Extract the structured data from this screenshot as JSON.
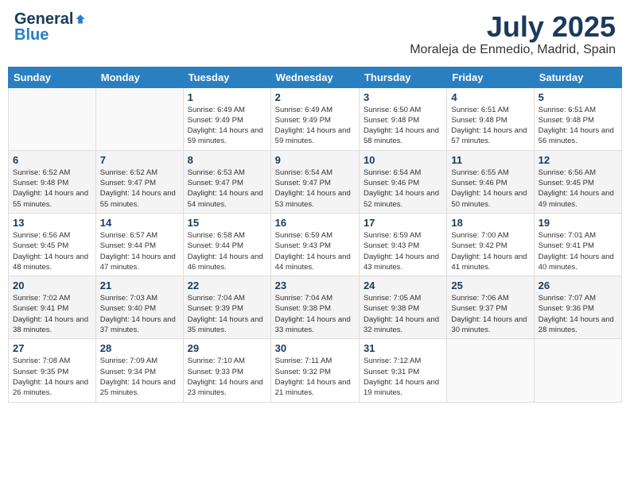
{
  "logo": {
    "general": "General",
    "blue": "Blue"
  },
  "header": {
    "title": "July 2025",
    "subtitle": "Moraleja de Enmedio, Madrid, Spain"
  },
  "weekdays": [
    "Sunday",
    "Monday",
    "Tuesday",
    "Wednesday",
    "Thursday",
    "Friday",
    "Saturday"
  ],
  "weeks": [
    [
      {
        "day": null
      },
      {
        "day": null
      },
      {
        "day": "1",
        "sunrise": "6:49 AM",
        "sunset": "9:49 PM",
        "daylight": "14 hours and 59 minutes."
      },
      {
        "day": "2",
        "sunrise": "6:49 AM",
        "sunset": "9:49 PM",
        "daylight": "14 hours and 59 minutes."
      },
      {
        "day": "3",
        "sunrise": "6:50 AM",
        "sunset": "9:48 PM",
        "daylight": "14 hours and 58 minutes."
      },
      {
        "day": "4",
        "sunrise": "6:51 AM",
        "sunset": "9:48 PM",
        "daylight": "14 hours and 57 minutes."
      },
      {
        "day": "5",
        "sunrise": "6:51 AM",
        "sunset": "9:48 PM",
        "daylight": "14 hours and 56 minutes."
      }
    ],
    [
      {
        "day": "6",
        "sunrise": "6:52 AM",
        "sunset": "9:48 PM",
        "daylight": "14 hours and 55 minutes."
      },
      {
        "day": "7",
        "sunrise": "6:52 AM",
        "sunset": "9:47 PM",
        "daylight": "14 hours and 55 minutes."
      },
      {
        "day": "8",
        "sunrise": "6:53 AM",
        "sunset": "9:47 PM",
        "daylight": "14 hours and 54 minutes."
      },
      {
        "day": "9",
        "sunrise": "6:54 AM",
        "sunset": "9:47 PM",
        "daylight": "14 hours and 53 minutes."
      },
      {
        "day": "10",
        "sunrise": "6:54 AM",
        "sunset": "9:46 PM",
        "daylight": "14 hours and 52 minutes."
      },
      {
        "day": "11",
        "sunrise": "6:55 AM",
        "sunset": "9:46 PM",
        "daylight": "14 hours and 50 minutes."
      },
      {
        "day": "12",
        "sunrise": "6:56 AM",
        "sunset": "9:45 PM",
        "daylight": "14 hours and 49 minutes."
      }
    ],
    [
      {
        "day": "13",
        "sunrise": "6:56 AM",
        "sunset": "9:45 PM",
        "daylight": "14 hours and 48 minutes."
      },
      {
        "day": "14",
        "sunrise": "6:57 AM",
        "sunset": "9:44 PM",
        "daylight": "14 hours and 47 minutes."
      },
      {
        "day": "15",
        "sunrise": "6:58 AM",
        "sunset": "9:44 PM",
        "daylight": "14 hours and 46 minutes."
      },
      {
        "day": "16",
        "sunrise": "6:59 AM",
        "sunset": "9:43 PM",
        "daylight": "14 hours and 44 minutes."
      },
      {
        "day": "17",
        "sunrise": "6:59 AM",
        "sunset": "9:43 PM",
        "daylight": "14 hours and 43 minutes."
      },
      {
        "day": "18",
        "sunrise": "7:00 AM",
        "sunset": "9:42 PM",
        "daylight": "14 hours and 41 minutes."
      },
      {
        "day": "19",
        "sunrise": "7:01 AM",
        "sunset": "9:41 PM",
        "daylight": "14 hours and 40 minutes."
      }
    ],
    [
      {
        "day": "20",
        "sunrise": "7:02 AM",
        "sunset": "9:41 PM",
        "daylight": "14 hours and 38 minutes."
      },
      {
        "day": "21",
        "sunrise": "7:03 AM",
        "sunset": "9:40 PM",
        "daylight": "14 hours and 37 minutes."
      },
      {
        "day": "22",
        "sunrise": "7:04 AM",
        "sunset": "9:39 PM",
        "daylight": "14 hours and 35 minutes."
      },
      {
        "day": "23",
        "sunrise": "7:04 AM",
        "sunset": "9:38 PM",
        "daylight": "14 hours and 33 minutes."
      },
      {
        "day": "24",
        "sunrise": "7:05 AM",
        "sunset": "9:38 PM",
        "daylight": "14 hours and 32 minutes."
      },
      {
        "day": "25",
        "sunrise": "7:06 AM",
        "sunset": "9:37 PM",
        "daylight": "14 hours and 30 minutes."
      },
      {
        "day": "26",
        "sunrise": "7:07 AM",
        "sunset": "9:36 PM",
        "daylight": "14 hours and 28 minutes."
      }
    ],
    [
      {
        "day": "27",
        "sunrise": "7:08 AM",
        "sunset": "9:35 PM",
        "daylight": "14 hours and 26 minutes."
      },
      {
        "day": "28",
        "sunrise": "7:09 AM",
        "sunset": "9:34 PM",
        "daylight": "14 hours and 25 minutes."
      },
      {
        "day": "29",
        "sunrise": "7:10 AM",
        "sunset": "9:33 PM",
        "daylight": "14 hours and 23 minutes."
      },
      {
        "day": "30",
        "sunrise": "7:11 AM",
        "sunset": "9:32 PM",
        "daylight": "14 hours and 21 minutes."
      },
      {
        "day": "31",
        "sunrise": "7:12 AM",
        "sunset": "9:31 PM",
        "daylight": "14 hours and 19 minutes."
      },
      {
        "day": null
      },
      {
        "day": null
      }
    ]
  ],
  "labels": {
    "sunrise": "Sunrise:",
    "sunset": "Sunset:",
    "daylight": "Daylight:"
  }
}
